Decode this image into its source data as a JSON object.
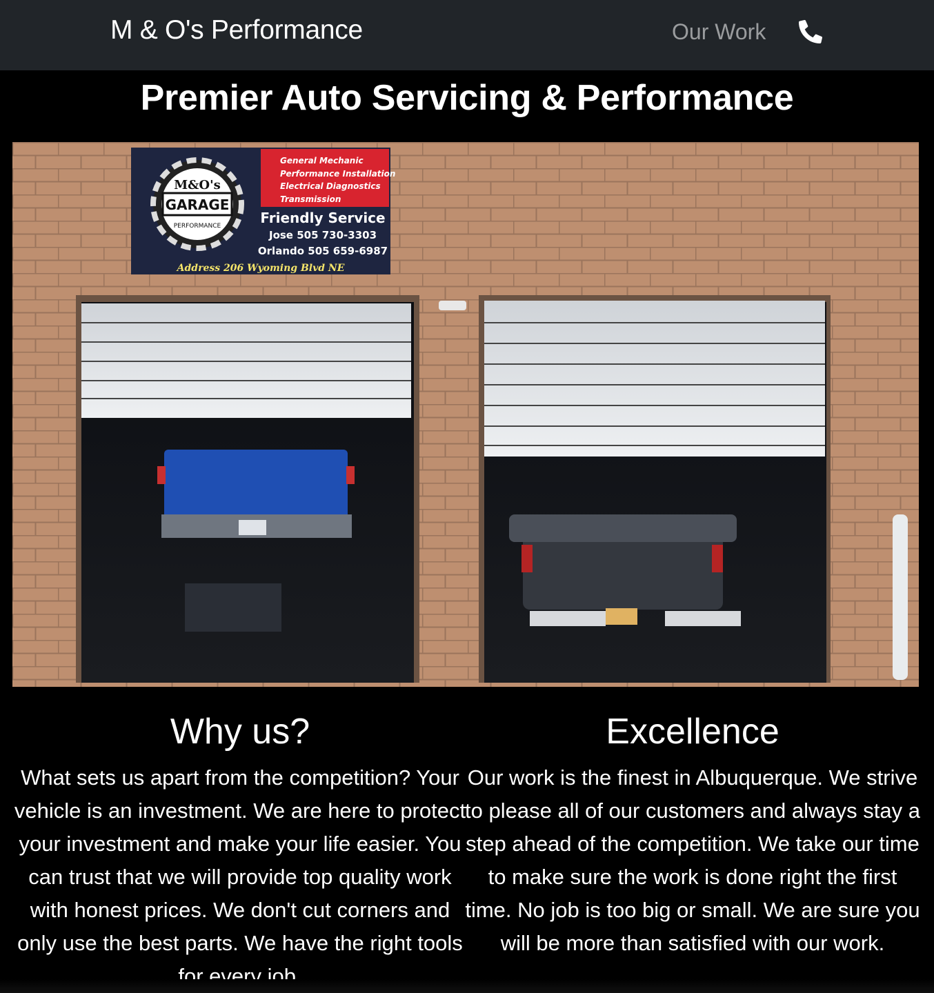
{
  "navbar": {
    "brand": "M & O's Performance",
    "links": [
      {
        "label": "Our Work"
      }
    ],
    "phone_icon": "phone-icon"
  },
  "hero": {
    "title": "Premier Auto Servicing & Performance",
    "sign": {
      "logo_text": "M&O's GARAGE AND PERFORMANCE",
      "services": [
        "General Mechanic",
        "Performance Installation",
        "Electrical Diagnostics",
        "Transmission"
      ],
      "tagline": "Friendly Service",
      "contact_1": "Jose 505 730-3303",
      "contact_2": "Orlando 505 659-6987",
      "address": "Address 206 Wyoming Blvd NE"
    }
  },
  "sections": [
    {
      "heading": "Why us?",
      "body": "What sets us apart from the competition? Your vehicle is an investment. We are here to protect your investment and make your life easier. You can trust that we will provide top quality work with honest prices. We don't cut corners and only use the best parts. We have the right tools for every job."
    },
    {
      "heading": "Excellence",
      "body": "Our work is the finest in Albuquerque. We strive to please all of our customers and always stay a step ahead of the competition. We take our time to make sure the work is done right the first time. No job is too big or small. We are sure you will be more than satisfied with our work."
    }
  ],
  "colors": {
    "navbar_bg": "#212529",
    "page_bg": "#000000",
    "nav_link": "rgba(255,255,255,0.55)",
    "sign_red": "#d8242f",
    "sign_navy": "#1e2540",
    "brick": "#b98a6b"
  }
}
